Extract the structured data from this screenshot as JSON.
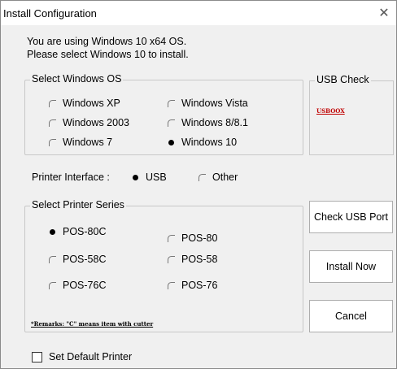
{
  "window": {
    "title": "Install Configuration",
    "close_glyph": "✕"
  },
  "message": {
    "line1": "You are using Windows 10 x64 OS.",
    "line2": "Please select Windows 10 to install."
  },
  "os_group": {
    "legend": "Select Windows OS",
    "options": [
      {
        "label": "Windows XP",
        "selected": false
      },
      {
        "label": "Windows Vista",
        "selected": false
      },
      {
        "label": "Windows 2003",
        "selected": false
      },
      {
        "label": "Windows 8/8.1",
        "selected": false
      },
      {
        "label": "Windows 7",
        "selected": false
      },
      {
        "label": "Windows 10",
        "selected": true
      }
    ]
  },
  "usb_check": {
    "legend": "USB Check",
    "status": "USBOOX",
    "status_color": "#c00000"
  },
  "printer_interface": {
    "label": "Printer Interface :",
    "options": [
      {
        "label": "USB",
        "selected": true
      },
      {
        "label": "Other",
        "selected": false
      }
    ]
  },
  "printer_group": {
    "legend": "Select Printer Series",
    "options": [
      {
        "label": "POS-80C",
        "selected": true
      },
      {
        "label": "POS-80",
        "selected": false
      },
      {
        "label": "POS-58C",
        "selected": false
      },
      {
        "label": "POS-58",
        "selected": false
      },
      {
        "label": "POS-76C",
        "selected": false
      },
      {
        "label": "POS-76",
        "selected": false
      }
    ],
    "remarks": "*Remarks: \"C\" means item with cutter"
  },
  "buttons": {
    "check_usb": "Check USB Port",
    "install": "Install Now",
    "cancel": "Cancel"
  },
  "default_printer": {
    "label": "Set Default Printer",
    "checked": false
  }
}
